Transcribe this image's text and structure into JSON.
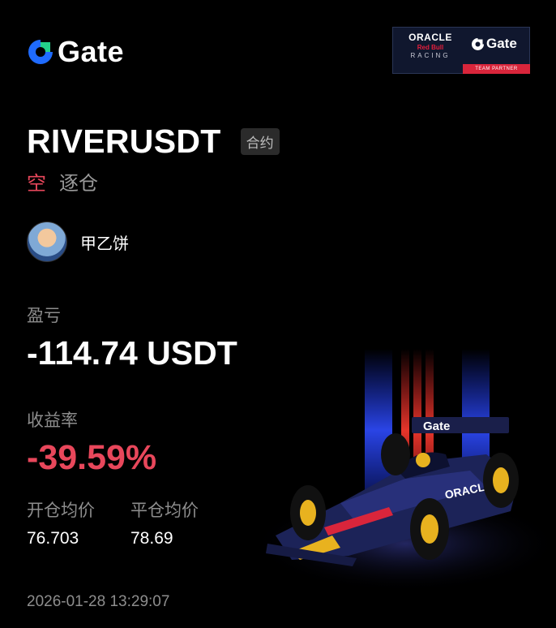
{
  "brand": {
    "name": "Gate",
    "accent": "#1f6bff"
  },
  "partner_badge": {
    "oracle": "ORACLE",
    "redbull": "Red Bull",
    "racing": "RACING",
    "gate": "Gate",
    "band": "TEAM PARTNER"
  },
  "position": {
    "symbol": "RIVERUSDT",
    "contract_tag": "合约",
    "side": "空",
    "margin_mode": "逐仓"
  },
  "user": {
    "name": "甲乙饼"
  },
  "pnl": {
    "label": "盈亏",
    "value": "-114.74 USDT"
  },
  "roi": {
    "label": "收益率",
    "value": "-39.59%",
    "color": "#e8475b"
  },
  "entry_price": {
    "label": "开仓均价",
    "value": "76.703"
  },
  "exit_price": {
    "label": "平仓均价",
    "value": "78.69"
  },
  "timestamp": "2026-01-28 13:29:07",
  "car_livery": {
    "text": "ORACLE",
    "nose_text": "Gate"
  }
}
